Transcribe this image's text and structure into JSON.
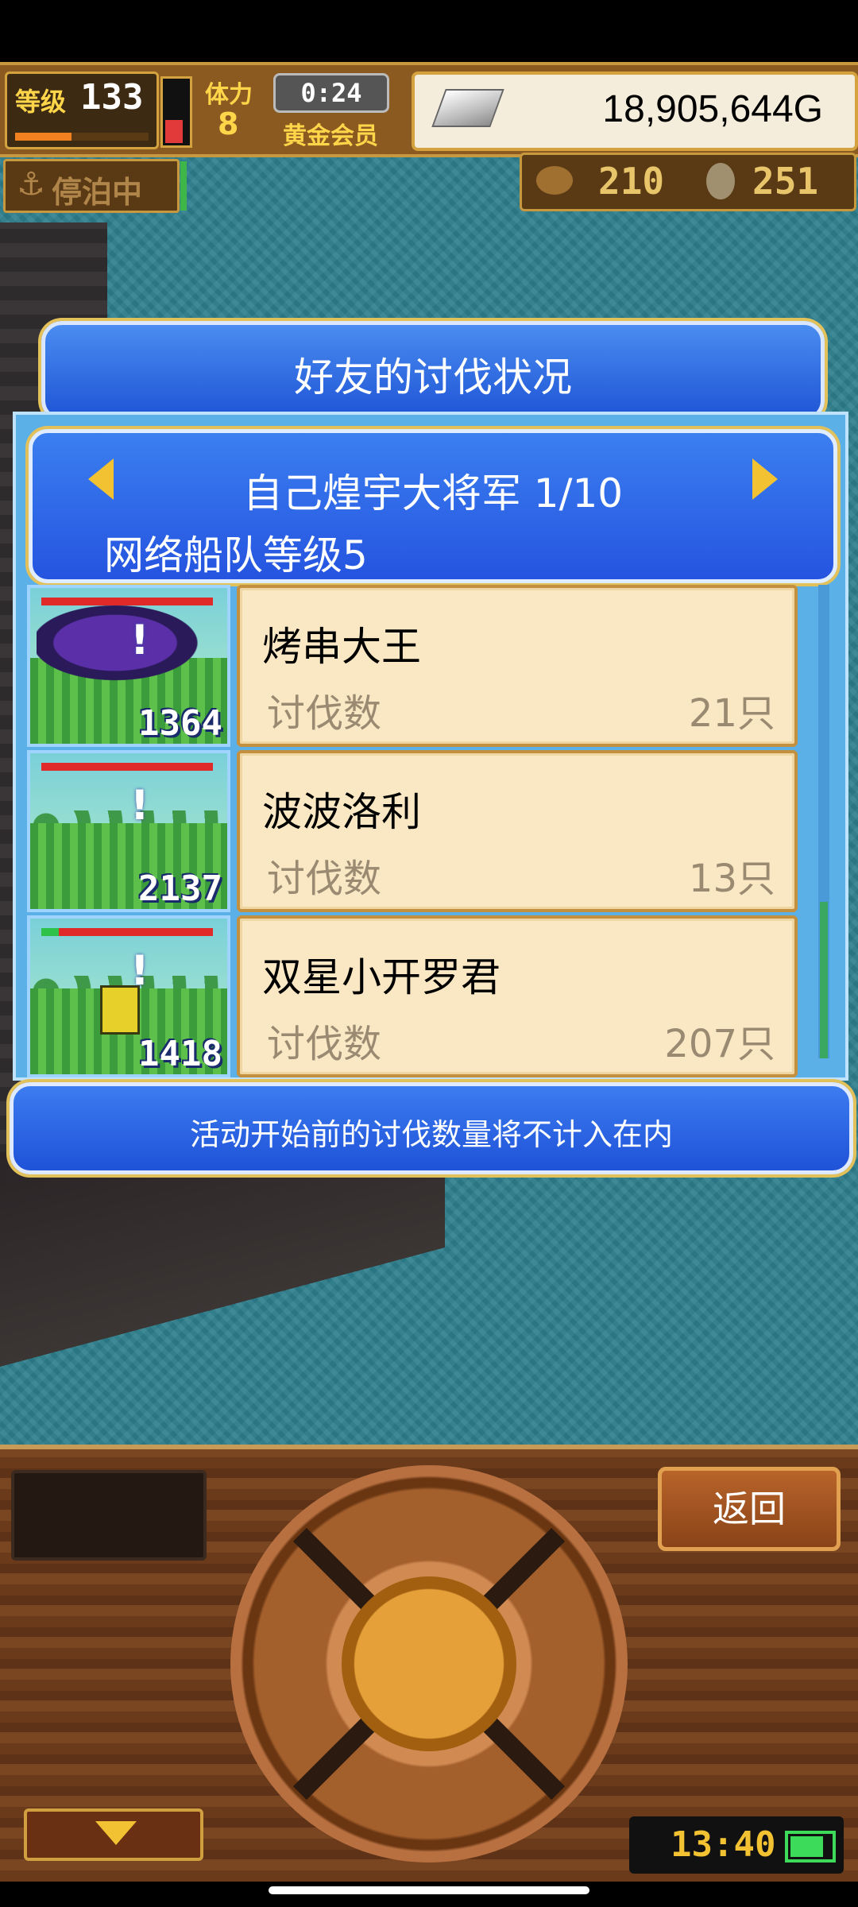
{
  "hud": {
    "level_label": "等级",
    "level": "133",
    "xp_fraction": 0.42,
    "health_fraction": 0.4,
    "stamina_label": "体力",
    "stamina": "8",
    "timer": "0:24",
    "membership": "黄金会员",
    "gold": "18,905,644G",
    "status": "停泊中",
    "resource_1": "210",
    "resource_2": "251"
  },
  "dialog": {
    "title": "好友的讨伐状况",
    "player_name": "自己煌宇大将军 1/10",
    "fleet_level": "网络船队等级5",
    "friends": [
      {
        "name": "烤串大王",
        "stat_label": "讨伐数",
        "count": "21只",
        "power": "1364",
        "hp_fraction": 1.0,
        "hp_color": "#e02a2a",
        "image": "purple-monster"
      },
      {
        "name": "波波洛利",
        "stat_label": "讨伐数",
        "count": "13只",
        "power": "2137",
        "hp_fraction": 1.0,
        "hp_color": "#e02a2a",
        "image": "empty-field"
      },
      {
        "name": "双星小开罗君",
        "stat_label": "讨伐数",
        "count": "207只",
        "power": "1418",
        "hp_fraction": 0.1,
        "hp_color": "#e02a2a",
        "image": "yellow-hero"
      }
    ],
    "scroll_fraction": 0.33,
    "footer_note": "活动开始前的讨伐数量将不计入在内"
  },
  "controller": {
    "back_label": "返回",
    "clock": "13:40",
    "battery_fraction": 0.85
  }
}
